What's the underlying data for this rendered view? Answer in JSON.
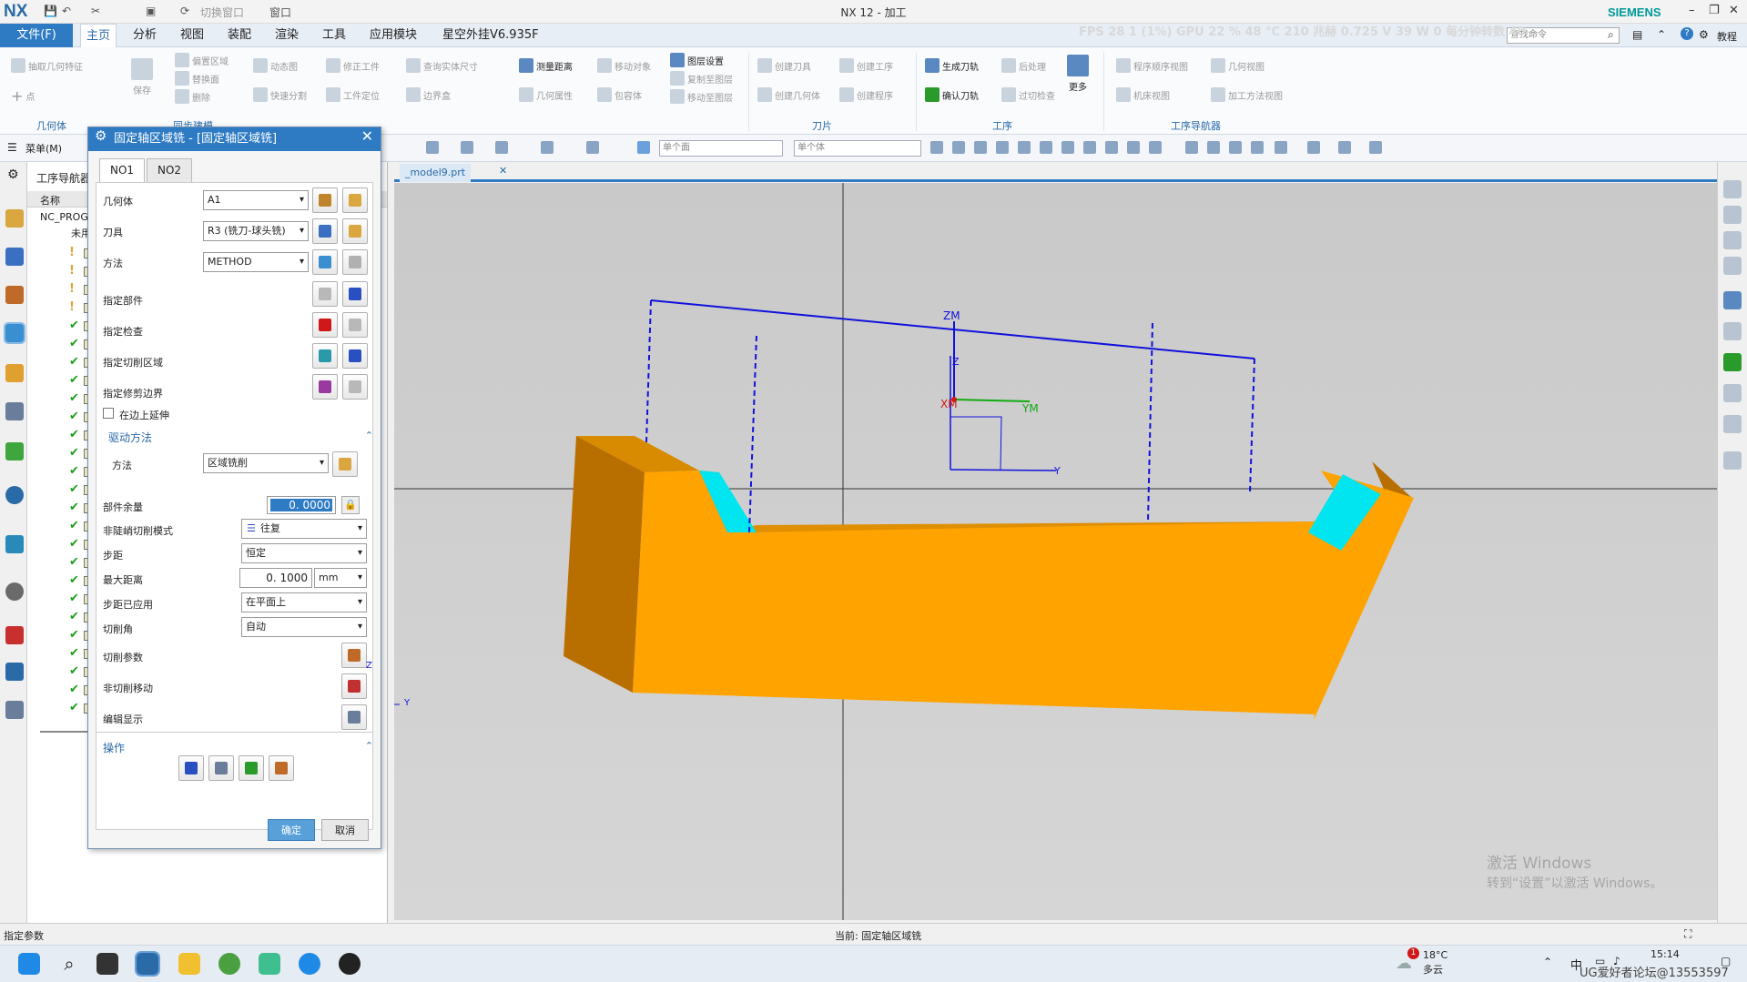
{
  "titlebar": {
    "logo": "NX",
    "window_menu": "窗口",
    "switch_window": "切换窗口",
    "title": "NX 12 - 加工",
    "fps": "FPS  28   1 (1%) GPU 22 % 48 °C 210 兆赫 0.725 V 39 W 0 每分钟转数 40",
    "brand": "SIEMENS",
    "search_placeholder": "查找命令",
    "tutorial": "教程"
  },
  "menubar": {
    "file": "文件(F)",
    "tabs": [
      "主页",
      "分析",
      "视图",
      "装配",
      "渲染",
      "工具",
      "应用模块",
      "星空外挂V6.935F"
    ]
  },
  "ribbon": {
    "col1": [
      "抽取几何特征",
      "点"
    ],
    "save": "保存",
    "col3": [
      "偏置区域",
      "替换面",
      "删除"
    ],
    "col4": [
      "动态图",
      "快速分割"
    ],
    "col5": [
      "修正工件",
      "工件定位"
    ],
    "col6": [
      "查询实体尺寸",
      "边界盒"
    ],
    "col7": [
      "测量距离",
      "几何属性"
    ],
    "col8": [
      "移动对象",
      "包容体"
    ],
    "col9": [
      "图层设置",
      "复制至图层",
      "移动至图层"
    ],
    "col10": [
      "创建刀具",
      "创建几何体"
    ],
    "col11": [
      "创建工序",
      "创建程序"
    ],
    "col12": [
      "生成刀轨",
      "确认刀轨"
    ],
    "col13": [
      "后处理",
      "过切检查"
    ],
    "more": "更多",
    "col14": [
      "程序顺序视图",
      "机床视图"
    ],
    "col15": [
      "几何视图",
      "加工方法视图"
    ],
    "groups": [
      "几何体",
      "同步建模",
      "刀片",
      "工序",
      "工序导航器"
    ]
  },
  "toolbar2": {
    "menu": "菜单(M)",
    "combo1": "单个面",
    "combo2": "单个体"
  },
  "navigator": {
    "title": "工序导航器",
    "col_name": "名称",
    "root": "NC_PROG",
    "unused": "未用"
  },
  "dialog": {
    "title": "固定轴区域铣 - [固定轴区域铣]",
    "tabs": [
      "NO1",
      "NO2"
    ],
    "geometry_label": "几何体",
    "geometry_value": "A1",
    "tool_label": "刀具",
    "tool_value": "R3 (铣刀-球头铣)",
    "method_label": "方法",
    "method_value": "METHOD",
    "part_label": "指定部件",
    "check_label": "指定检查",
    "cut_area_label": "指定切削区域",
    "trim_label": "指定修剪边界",
    "extend_label": "在边上延伸",
    "drive_section": "驱动方法",
    "drive_method_label": "方法",
    "drive_method_value": "区域铣削",
    "stock_label": "部件余量",
    "stock_value": "0. 0000",
    "nonsteep_label": "非陡峭切削模式",
    "nonsteep_value": "往复",
    "stepover_label": "步距",
    "stepover_value": "恒定",
    "maxdist_label": "最大距离",
    "maxdist_value": "0. 1000",
    "maxdist_unit": "mm",
    "applied_label": "步距已应用",
    "applied_value": "在平面上",
    "angle_label": "切削角",
    "angle_value": "自动",
    "cutparams_label": "切削参数",
    "noncut_label": "非切削移动",
    "edit_label": "编辑显示",
    "actions_section": "操作",
    "ok": "确定",
    "cancel": "取消"
  },
  "graphics": {
    "tab": "_model9.prt",
    "zm": "ZM",
    "ym": "YM",
    "xm": "XM",
    "z": "Z",
    "y": "Y",
    "triad_z": "Z",
    "triad_y": "Y",
    "activate1": "激活 Windows",
    "activate2": "转到“设置”以激活 Windows。"
  },
  "status": {
    "left": "指定参数",
    "middle": "当前: 固定轴区域铣"
  },
  "taskbar": {
    "temp": "18°C",
    "weather": "多云",
    "ime": "中",
    "time": "15:14",
    "watermark": "UG爱好者论坛@13553597"
  },
  "colors": {
    "accent": "#2e7bc4",
    "part": "#ffa300",
    "part_dark": "#b96f00",
    "face_sel": "#00e5ef",
    "wire": "#1111dd"
  }
}
